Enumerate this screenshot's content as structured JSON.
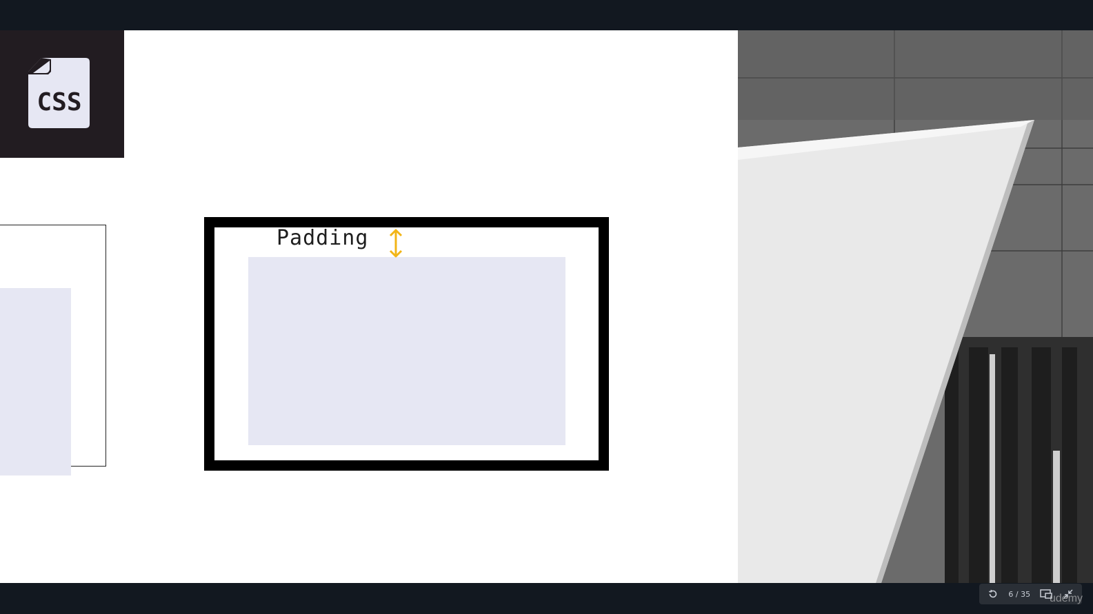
{
  "slide": {
    "logo_text": "CSS",
    "annotation_label": "Padding"
  },
  "player": {
    "page_indicator": "6 / 35",
    "watermark": "udemy"
  },
  "icons": {
    "replay": "replay-icon",
    "pip": "picture-in-picture-icon",
    "exit_fullscreen": "exit-fullscreen-icon",
    "padding_arrow": "double-arrow-vertical-icon"
  },
  "colors": {
    "badge_bg": "#221c21",
    "logo_fill": "#e6e7f3",
    "content_fill": "#e6e7f3",
    "arrow": "#f2b517"
  }
}
